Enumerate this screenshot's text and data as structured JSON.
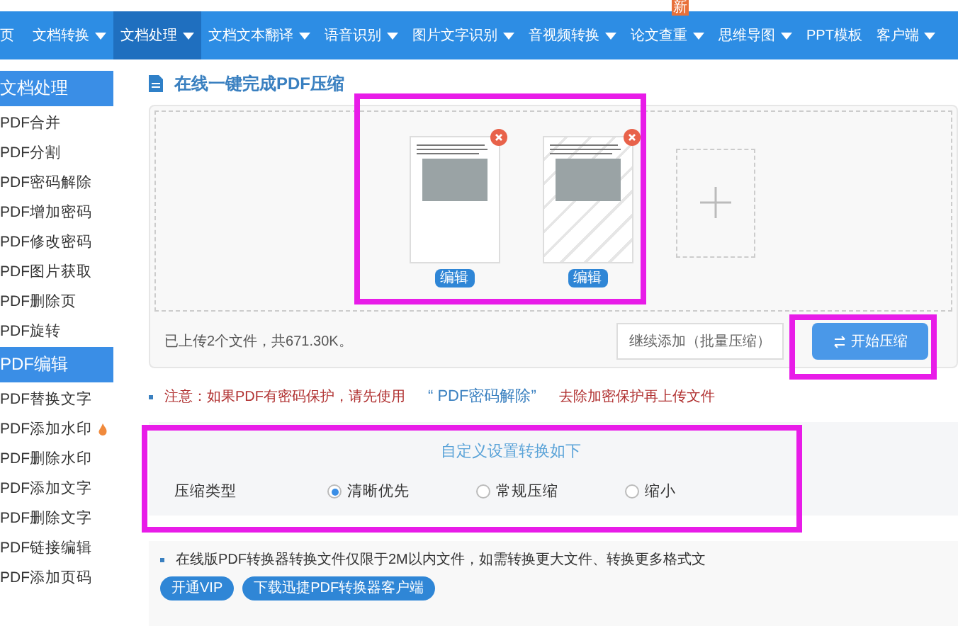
{
  "nav": {
    "items": [
      {
        "label": "页",
        "dropdown": false,
        "selected": false
      },
      {
        "label": "文档转换",
        "dropdown": true,
        "selected": false
      },
      {
        "label": "文档处理",
        "dropdown": true,
        "selected": true
      },
      {
        "label": "文档文本翻译",
        "dropdown": true,
        "selected": false
      },
      {
        "label": "语音识别",
        "dropdown": true,
        "selected": false
      },
      {
        "label": "图片文字识别",
        "dropdown": true,
        "selected": false
      },
      {
        "label": "音视频转换",
        "dropdown": true,
        "selected": false
      },
      {
        "label": "论文查重",
        "dropdown": true,
        "selected": false,
        "badge": "新"
      },
      {
        "label": "思维导图",
        "dropdown": true,
        "selected": false
      },
      {
        "label": "PPT模板",
        "dropdown": false,
        "selected": false
      },
      {
        "label": "客户端",
        "dropdown": true,
        "selected": false
      }
    ]
  },
  "sidebar": {
    "sections": [
      {
        "title": "文档处理",
        "items": [
          {
            "label": "PDF合并"
          },
          {
            "label": "PDF分割"
          },
          {
            "label": "PDF密码解除"
          },
          {
            "label": "PDF增加密码"
          },
          {
            "label": "PDF修改密码"
          },
          {
            "label": "PDF图片获取"
          },
          {
            "label": "PDF删除页"
          },
          {
            "label": "PDF旋转"
          }
        ]
      },
      {
        "title": "PDF编辑",
        "items": [
          {
            "label": "PDF替换文字"
          },
          {
            "label": "PDF添加水印",
            "hot": true
          },
          {
            "label": "PDF删除水印"
          },
          {
            "label": "PDF添加文字"
          },
          {
            "label": "PDF删除文字"
          },
          {
            "label": "PDF链接编辑"
          },
          {
            "label": "PDF添加页码"
          }
        ]
      }
    ]
  },
  "main": {
    "title": "在线一键完成PDF压缩",
    "files": [
      {
        "edit": "编辑",
        "pattern": false
      },
      {
        "edit": "编辑",
        "pattern": true
      }
    ],
    "status": "已上传2个文件，共671.30K。",
    "add_button": "继续添加（批量压缩）",
    "start_button": "开始压缩",
    "notice": {
      "before": "注意：如果PDF有密码保护，请先使用",
      "link": "“ PDF密码解除”",
      "after": "去除加密保护再上传文件"
    },
    "settings": {
      "title": "自定义设置转换如下",
      "label": "压缩类型",
      "options": [
        {
          "label": "清晰优先",
          "selected": true
        },
        {
          "label": "常规压缩",
          "selected": false
        },
        {
          "label": "缩小",
          "selected": false
        }
      ]
    },
    "info": {
      "text": "在线版PDF转换器转换文件仅限于2M以内文件，如需转换更大文件、转换更多格式文",
      "buttons": [
        "开通VIP",
        "下载迅捷PDF转换器客户端"
      ]
    }
  }
}
